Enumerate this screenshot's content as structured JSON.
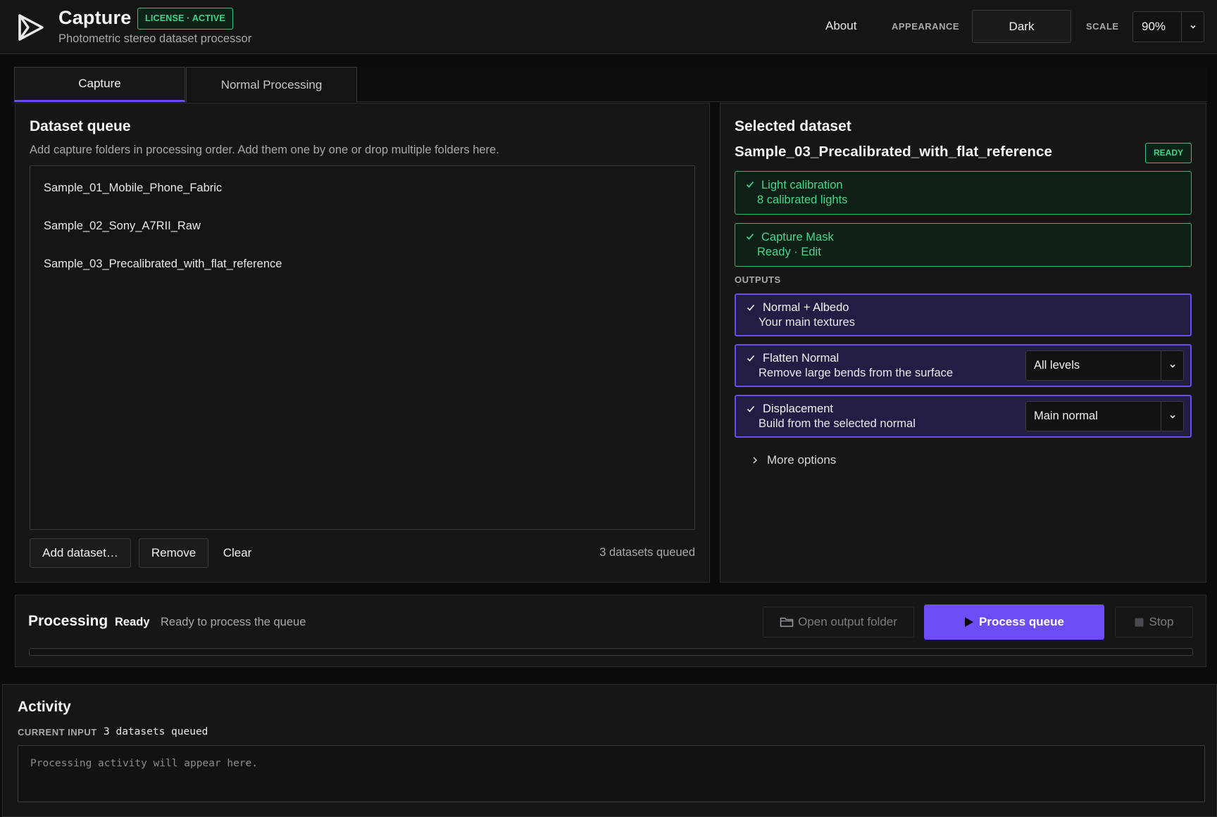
{
  "colors": {
    "accent": "#6d4cf5",
    "success": "#34c77b",
    "background": "#0b0b0c",
    "panel": "#161617"
  },
  "header": {
    "logo_icon": "play-triangle-logo-icon",
    "title": "Capture",
    "license_badge": "LICENSE · ACTIVE",
    "subtitle": "Photometric stereo dataset processor",
    "about": "About",
    "appearance_label": "APPEARANCE",
    "appearance_value": "Dark",
    "scale_label": "SCALE",
    "scale_value": "90%"
  },
  "tabs": [
    {
      "label": "Capture",
      "active": true
    },
    {
      "label": "Normal Processing",
      "active": false
    }
  ],
  "queue": {
    "title": "Dataset queue",
    "description": "Add capture folders in processing order. Add them one by one or drop multiple folders here.",
    "items": [
      "Sample_01_Mobile_Phone_Fabric",
      "Sample_02_Sony_A7RII_Raw",
      "Sample_03_Precalibrated_with_flat_reference"
    ],
    "add_button": "Add dataset…",
    "remove_button": "Remove",
    "clear_button": "Clear",
    "count_text": "3 datasets queued"
  },
  "selected": {
    "title": "Selected dataset",
    "name": "Sample_03_Precalibrated_with_flat_reference",
    "status_badge": "READY",
    "light_calibration": {
      "title": "Light calibration",
      "detail": "8 calibrated lights"
    },
    "capture_mask": {
      "title": "Capture Mask",
      "detail": "Ready · Edit"
    },
    "outputs_label": "OUTPUTS",
    "outputs": [
      {
        "title": "Normal + Albedo",
        "detail": "Your main textures"
      },
      {
        "title": "Flatten Normal",
        "detail": "Remove large bends from the surface",
        "select": "All levels"
      },
      {
        "title": "Displacement",
        "detail": "Build from the selected normal",
        "select": "Main normal"
      }
    ],
    "more_options": "More options"
  },
  "processing": {
    "title": "Processing",
    "status": "Ready",
    "description": "Ready to process the queue",
    "open_folder": "Open output folder",
    "process_queue": "Process queue",
    "stop": "Stop",
    "progress": 0
  },
  "activity": {
    "title": "Activity",
    "current_input_label": "CURRENT INPUT",
    "current_input_value": "3 datasets queued",
    "placeholder": "Processing activity will appear here."
  }
}
